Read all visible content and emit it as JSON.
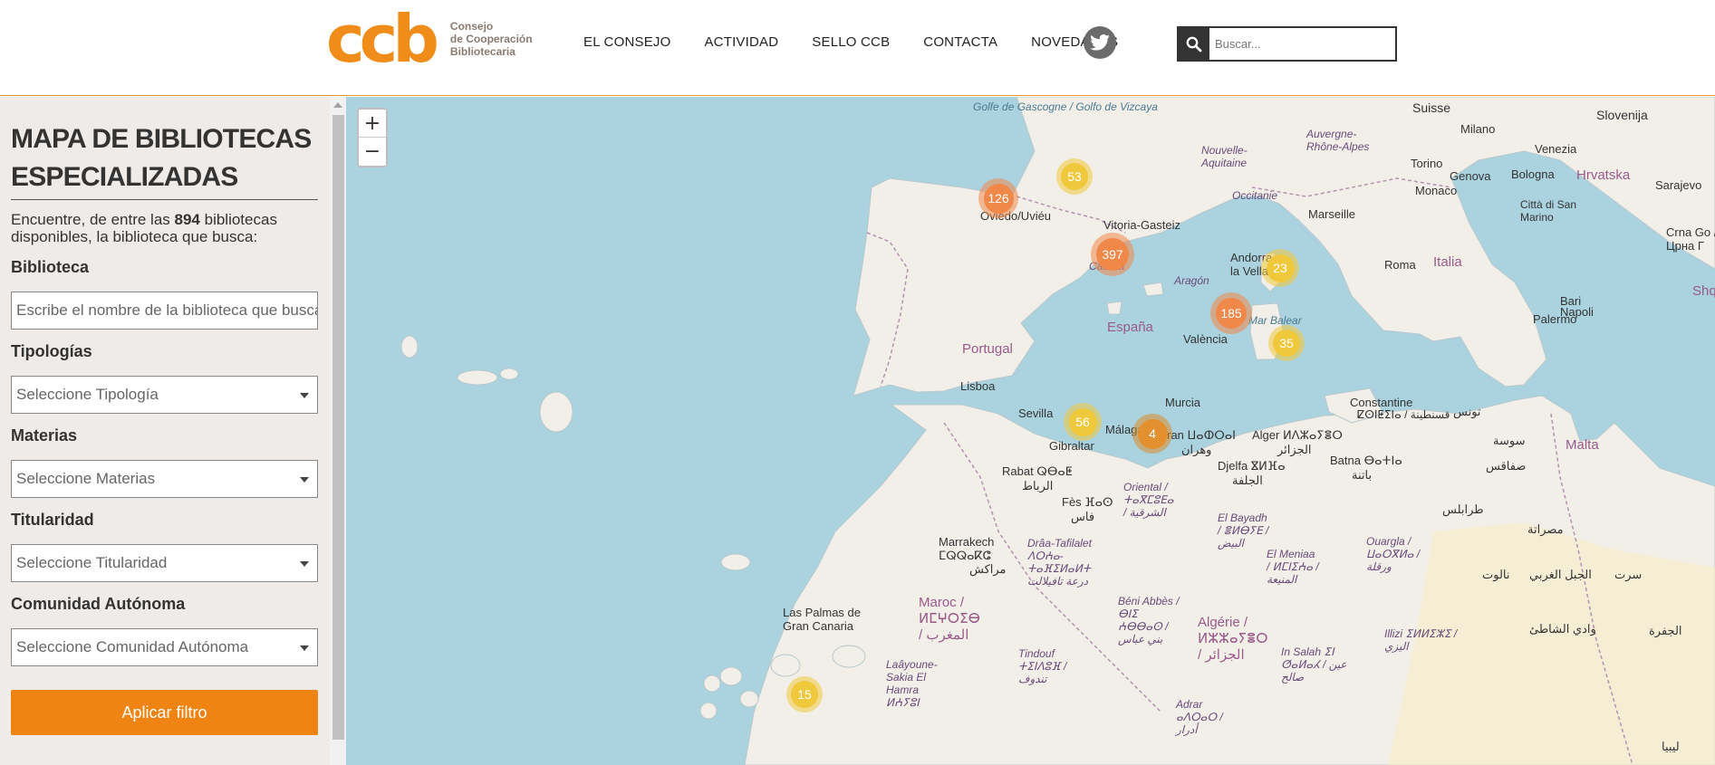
{
  "header": {
    "logo_mark": "ccb",
    "logo_lines": [
      "Consejo",
      "de Cooperación",
      "Bibliotecaria"
    ],
    "nav": [
      "EL CONSEJO",
      "ACTIVIDAD",
      "SELLO CCB",
      "CONTACTA",
      "NOVEDADES"
    ],
    "twitter_icon": "twitter-icon",
    "search_placeholder": "Buscar..."
  },
  "sidebar": {
    "title_line1": "MAPA DE BIBLIOTECAS",
    "title_line2": "ESPECIALIZADAS",
    "intro_prefix": "Encuentre, de entre las ",
    "intro_count": "894",
    "intro_suffix": " bibliotecas disponibles, la biblioteca que busca:",
    "biblioteca_label": "Biblioteca",
    "biblioteca_placeholder": "Escribe el nombre de la biblioteca que busca",
    "tipologias_label": "Tipologías",
    "tipologias_value": "Seleccione Tipología",
    "materias_label": "Materias",
    "materias_value": "Seleccione Materias",
    "titularidad_label": "Titularidad",
    "titularidad_value": "Seleccione Titularidad",
    "comunidad_label": "Comunidad Autónoma",
    "comunidad_value": "Seleccione Comunidad Autónoma",
    "apply_button": "Aplicar filtro"
  },
  "map": {
    "zoom_in": "+",
    "zoom_out": "−",
    "colors": {
      "sea": "#aad3df",
      "land": "#f2efe9",
      "cluster_orange": "#f0884a",
      "cluster_yellow": "#f0c83c"
    },
    "clusters": [
      {
        "count": "53",
        "color": "yellow"
      },
      {
        "count": "126",
        "color": "orange"
      },
      {
        "count": "397",
        "color": "orange"
      },
      {
        "count": "23",
        "color": "yellow"
      },
      {
        "count": "185",
        "color": "orange"
      },
      {
        "count": "35",
        "color": "yellow"
      },
      {
        "count": "56",
        "color": "yellow"
      },
      {
        "count": "4",
        "color": "darkorange"
      },
      {
        "count": "15",
        "color": "yellow"
      }
    ],
    "labels": {
      "golfe": "Golfe de Gascogne / Golfo de Vizcaya",
      "suisse": "Suisse",
      "slovenija": "Slovenija",
      "nouvelle_aquitaine": "Nouvelle-Aquitaine",
      "auvergne": "Auvergne-Rhône-Alpes",
      "milano": "Milano",
      "venezia": "Venezia",
      "torino": "Torino",
      "genova": "Genova",
      "bologna": "Bologna",
      "hrvatska": "Hrvatska",
      "sarajevo": "Sarajevo",
      "monaco": "Monaco",
      "occitanie": "Occitanie",
      "marseille": "Marseille",
      "citta": "Città di San Marino",
      "oviedo": "Oviedo/Uviéu",
      "vitoria": "Vitoria-Gasteiz",
      "andorra": "Andorra la Vella",
      "roma": "Roma",
      "italia": "Italia",
      "crna_gora": "Crna Go / Црна Г",
      "castilla": "Castilla",
      "aragon": "Aragón",
      "espana": "España",
      "portugal": "Portugal",
      "valencia": "València",
      "mar_baleares": "Mar Balear",
      "bari": "Bari",
      "napoli": "Napoli",
      "shq": "Shq",
      "lisboa": "Lisboa",
      "palermo": "Palermo",
      "sevilla": "Sevilla",
      "murcia": "Murcia",
      "malaga": "Málaga",
      "constantine": "Constantine",
      "constantine_ar": "ⵇⵙⵏⵟⵉⵏⴰ / قسنطينة",
      "tounes": "تونس",
      "oran": "Oran ⵡⴰⵀⵔⴰⵏ",
      "alger": "Alger ⵍⴷⵣⴰⵢⴻⵔ",
      "el_djazair": "الجزائر",
      "wahran": "وهران",
      "gibraltar": "Gibraltar",
      "sousse": "سوسة",
      "safaqis": "صفاقس",
      "malta": "Malta",
      "rabat": "Rabat ⵕⴱⴰⵟ",
      "rabat_ar": "الرباط",
      "djelfa": "Djelfa ⴵⵍⴼⴰ",
      "djelfa_ar": "الجلفة",
      "batna": "Batna ⴱⴰⵜⵏⴰ",
      "batna_ar": "باتنة",
      "fes": "Fès ⴼⴰⵙ",
      "fes_ar": "فاس",
      "oriental": "Oriental / ⵜⴰⴳⵎⵓⴹⴰ / الشرقية",
      "el_bayadh": "El Bayadh / ⴻⵍⴱⵢⴹ / البيض",
      "tarabulus": "طرابلس",
      "misrata": "مصراتة",
      "marrakech": "Marrakech ⵎⵕⵕⴰⴽⵛ",
      "marrakech_ar": "مراكش",
      "draa": "Drâa-Tafilalet ⴷⵔⵄⴰ-ⵜⴰⴼⵉⵍⴰⵍⵜ درعة تافيلالت",
      "el_meniaa": "El Meniaa / ⵍⵎⵏⵉⵄⴰ / المنيعة",
      "ouargla": "Ouargla / ⵡⴰⵔⴳⵍⴰ / ورقلة",
      "nalut": "نالوت",
      "jabal": "الجبل الغربي",
      "sirte": "سرت",
      "maroc": "Maroc / ⵍⵎⵖⵔⵉⴱ / المغرب",
      "las_palmas": "Las Palmas de Gran Canaria",
      "beni_abbes": "Béni Abbès / ⴱⵏⵉ ⵄⴱⴱⴰⵙ / بني عباس",
      "algerie": "Algérie / ⵍⵣⵣⴰⵢⴻⵔ / الجزائر",
      "wadi": "وادي الشاطئ",
      "aljufra": "الجفرة",
      "illizi": "Illizi ⵉⵍⵍⵉⵣⵉ / اليزي",
      "tindouf": "Tindouf ⵜⵉⵏⴷⵓⴼ / تندوف",
      "laayoune": "Laâyoune-Sakia El Hamra ⵍⵄⵢⵓⵏ",
      "in_salah": "In Salah ⵉⵏ ⵚⴰⵍⴰⵃ / عين صالح",
      "adrar": "Adrar ⴰⴷⵔⴰⵔ / أدرار",
      "libya": "ليبيا"
    }
  }
}
